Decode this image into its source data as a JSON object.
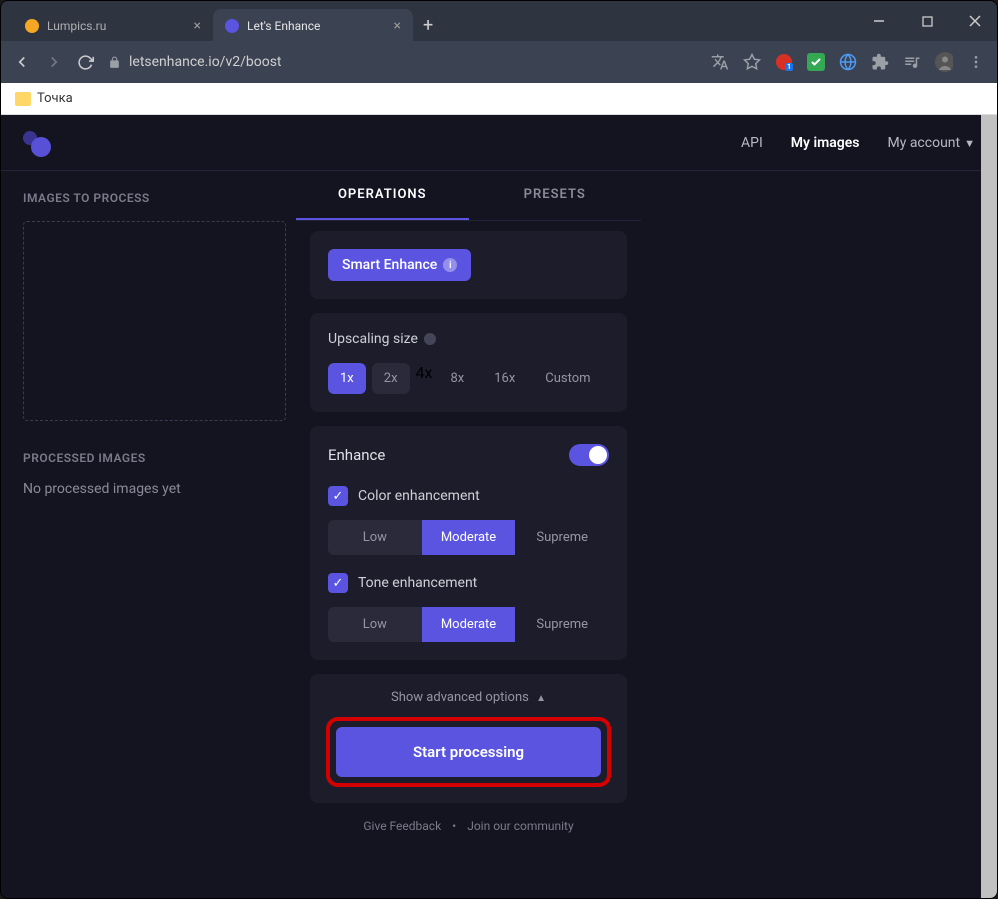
{
  "browser": {
    "tabs": [
      {
        "title": "Lumpics.ru",
        "active": false,
        "iconColor": "#f5a623"
      },
      {
        "title": "Let's Enhance",
        "active": true,
        "iconColor": "#5a54e0"
      }
    ],
    "url": "letsenhance.io/v2/boost",
    "bookmarks": [
      {
        "label": "Точка"
      }
    ]
  },
  "topnav": {
    "api": "API",
    "myimages": "My images",
    "account": "My account"
  },
  "left": {
    "toProcess": "IMAGES TO PROCESS",
    "processed": "PROCESSED IMAGES",
    "none": "No processed images yet"
  },
  "ptabs": {
    "operations": "OPERATIONS",
    "presets": "PRESETS"
  },
  "smartEnhance": "Smart Enhance",
  "upscale": {
    "title": "Upscaling size",
    "options": [
      "1x",
      "2x",
      "4x",
      "8x",
      "16x",
      "Custom"
    ]
  },
  "enhance": {
    "title": "Enhance",
    "color": {
      "label": "Color enhancement",
      "levels": [
        "Low",
        "Moderate",
        "Supreme"
      ]
    },
    "tone": {
      "label": "Tone enhancement",
      "levels": [
        "Low",
        "Moderate",
        "Supreme"
      ]
    }
  },
  "advanced": "Show advanced options",
  "start": "Start processing",
  "footer": {
    "feedback": "Give Feedback",
    "community": "Join our community"
  }
}
